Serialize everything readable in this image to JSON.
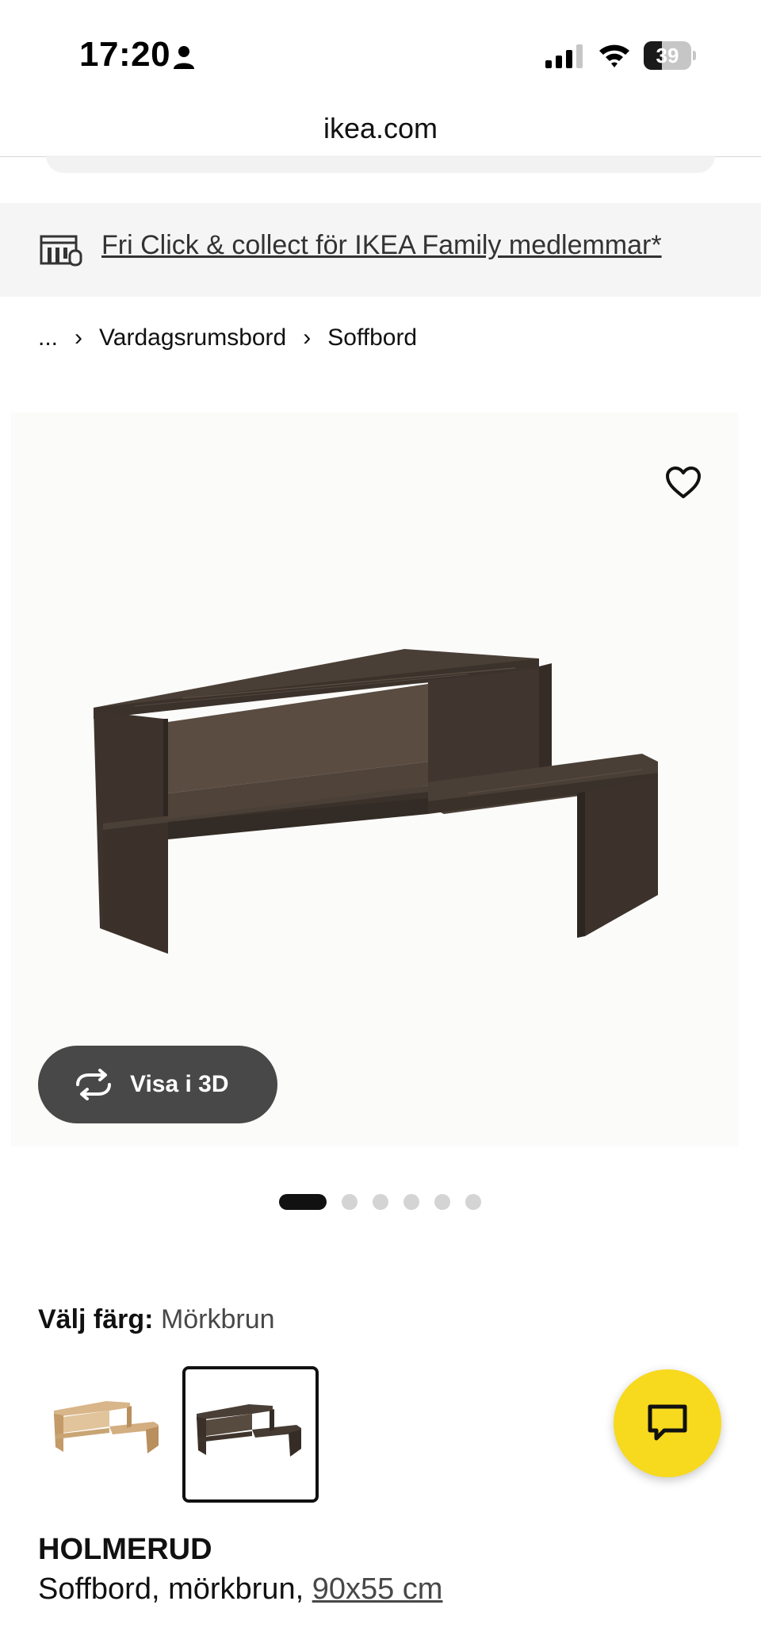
{
  "status_bar": {
    "time": "17:20",
    "battery_level": "39",
    "icons": [
      "person-icon",
      "signal-icon",
      "wifi-icon",
      "battery-icon"
    ]
  },
  "browser": {
    "url": "ikea.com"
  },
  "promo": {
    "icon": "store-icon",
    "text": "Fri Click & collect för IKEA Family medlemmar*"
  },
  "breadcrumb": {
    "items": [
      "...",
      "Vardagsrumsbord",
      "Soffbord"
    ],
    "separator_icon": "chevron-right-icon"
  },
  "gallery": {
    "favorite_icon": "heart-icon",
    "view3d_icon": "rotate-icon",
    "view3d_label": "Visa i 3D",
    "slide_count": 6,
    "active_slide": 1
  },
  "color_picker": {
    "label": "Välj färg:",
    "selected_value": "Mörkbrun",
    "options": [
      "light-oak-variant",
      "dark-brown-variant"
    ],
    "selected_index": 1,
    "colors": {
      "light": "#c9a574",
      "dark": "#3f342c"
    }
  },
  "chat": {
    "icon": "chat-icon",
    "color": "#f7d91e"
  },
  "product": {
    "name": "HOLMERUD",
    "description": "Soffbord, mörkbrun,",
    "size": "90x55 cm"
  }
}
